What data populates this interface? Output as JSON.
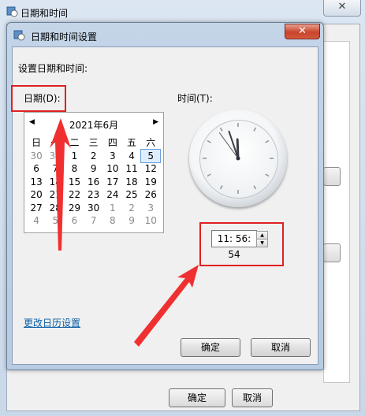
{
  "outer_window": {
    "title": "日期和时间",
    "bottom_ok": "确定",
    "bottom_cancel": "取消"
  },
  "dialog": {
    "title": "日期和时间设置",
    "close_glyph": "✕",
    "setting_label": "设置日期和时间:",
    "date_label": "日期(D):",
    "time_label": "时间(T):",
    "calendar": {
      "header": "2021年6月",
      "prev": "◀",
      "next": "▶",
      "weekdays": [
        "日",
        "一",
        "二",
        "三",
        "四",
        "五",
        "六"
      ],
      "days": [
        [
          "30",
          "31",
          "1",
          "2",
          "3",
          "4",
          "5"
        ],
        [
          "6",
          "7",
          "8",
          "9",
          "10",
          "11",
          "12"
        ],
        [
          "13",
          "14",
          "15",
          "16",
          "17",
          "18",
          "19"
        ],
        [
          "20",
          "21",
          "22",
          "23",
          "24",
          "25",
          "26"
        ],
        [
          "27",
          "28",
          "29",
          "30",
          "1",
          "2",
          "3"
        ],
        [
          "4",
          "5",
          "6",
          "7",
          "8",
          "9",
          "10"
        ]
      ],
      "selected_day": "5"
    },
    "clock": {
      "hour": 11,
      "minute": 56,
      "second": 54
    },
    "time_value": "11: 56: 54",
    "change_calendar_link": "更改日历设置",
    "ok_button": "确定",
    "cancel_button": "取消"
  },
  "colors": {
    "annotation_red": "#e02020",
    "link_blue": "#0a5fa8",
    "selection_blue": "#6a9ed8"
  }
}
